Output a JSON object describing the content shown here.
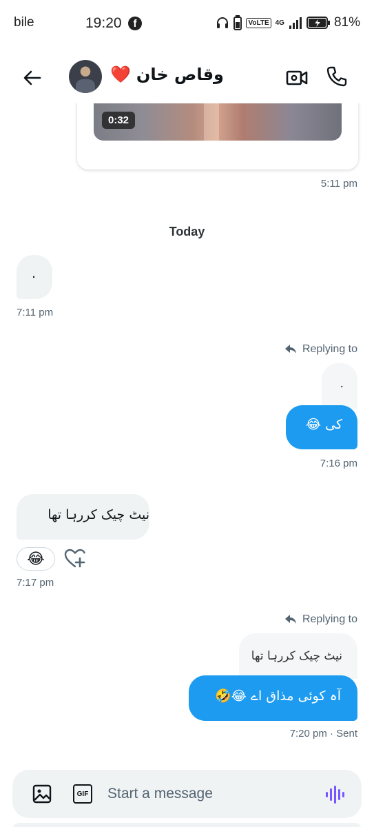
{
  "status_bar": {
    "carrier": "bile",
    "time": "19:20",
    "battery": "81%",
    "volte": "VoLTE",
    "network": "4G",
    "icons": [
      "facebook-icon",
      "headphones-icon",
      "battery-small-icon",
      "signal-icon",
      "battery-charging-icon"
    ]
  },
  "header": {
    "contact_name": "وقاص خان",
    "heart": "❤️",
    "icons": [
      "back-arrow-icon",
      "video-call-icon",
      "phone-icon"
    ]
  },
  "messages": {
    "video": {
      "duration": "0:32",
      "time": "5:11 pm"
    },
    "divider": "Today",
    "m1": {
      "text": ".",
      "time": "7:11 pm"
    },
    "m2": {
      "replying_label": "Replying to",
      "quoted": ".",
      "text": "کی 😂",
      "time": "7:16 pm"
    },
    "m3": {
      "text": "نیٹ چیک کررہا تھا",
      "reaction": "😂",
      "time": "7:17 pm"
    },
    "m4": {
      "replying_label": "Replying to",
      "quoted": "نیٹ چیک کررہا تھا",
      "text": "آہ کوئی مذاق اے 😂🤣",
      "time": "7:20 pm · Sent"
    }
  },
  "composer": {
    "placeholder": "Start a message",
    "gif_label": "GIF",
    "icons": [
      "image-icon",
      "gif-icon",
      "voice-icon"
    ]
  },
  "colors": {
    "accent": "#1d9bf0",
    "bubble_in": "#eff3f4",
    "secondary_text": "#536471",
    "voice": "#7856ff"
  }
}
